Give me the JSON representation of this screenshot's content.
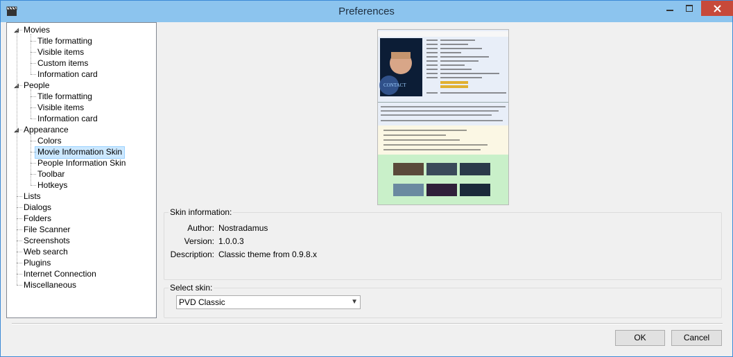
{
  "window": {
    "title": "Preferences",
    "controls": {
      "minimize": "minimize-icon",
      "maximize": "maximize-icon",
      "close": "close-icon"
    },
    "app_icon": "clapperboard-icon"
  },
  "tree": [
    {
      "label": "Movies",
      "level": 0,
      "expanded": true
    },
    {
      "label": "Title formatting",
      "level": 1
    },
    {
      "label": "Visible items",
      "level": 1
    },
    {
      "label": "Custom items",
      "level": 1
    },
    {
      "label": "Information card",
      "level": 1
    },
    {
      "label": "People",
      "level": 0,
      "expanded": true
    },
    {
      "label": "Title formatting",
      "level": 1
    },
    {
      "label": "Visible items",
      "level": 1
    },
    {
      "label": "Information card",
      "level": 1
    },
    {
      "label": "Appearance",
      "level": 0,
      "expanded": true
    },
    {
      "label": "Colors",
      "level": 1
    },
    {
      "label": "Movie Information Skin",
      "level": 1,
      "selected": true
    },
    {
      "label": "People Information Skin",
      "level": 1
    },
    {
      "label": "Toolbar",
      "level": 1
    },
    {
      "label": "Hotkeys",
      "level": 1
    },
    {
      "label": "Lists",
      "level": 0
    },
    {
      "label": "Dialogs",
      "level": 0
    },
    {
      "label": "Folders",
      "level": 0
    },
    {
      "label": "File Scanner",
      "level": 0
    },
    {
      "label": "Screenshots",
      "level": 0
    },
    {
      "label": "Web search",
      "level": 0
    },
    {
      "label": "Plugins",
      "level": 0
    },
    {
      "label": "Internet Connection",
      "level": 0
    },
    {
      "label": "Miscellaneous",
      "level": 0
    }
  ],
  "skin_info": {
    "group_label": "Skin information:",
    "author_label": "Author:",
    "author": "Nostradamus",
    "version_label": "Version:",
    "version": "1.0.0.3",
    "description_label": "Description:",
    "description": "Classic theme from 0.9.8.x"
  },
  "select_skin": {
    "group_label": "Select skin:",
    "selected": "PVD Classic"
  },
  "buttons": {
    "ok": "OK",
    "cancel": "Cancel"
  },
  "colors": {
    "titlebar": "#8cc4ee",
    "selection": "#cce8ff",
    "close": "#c7493a"
  }
}
